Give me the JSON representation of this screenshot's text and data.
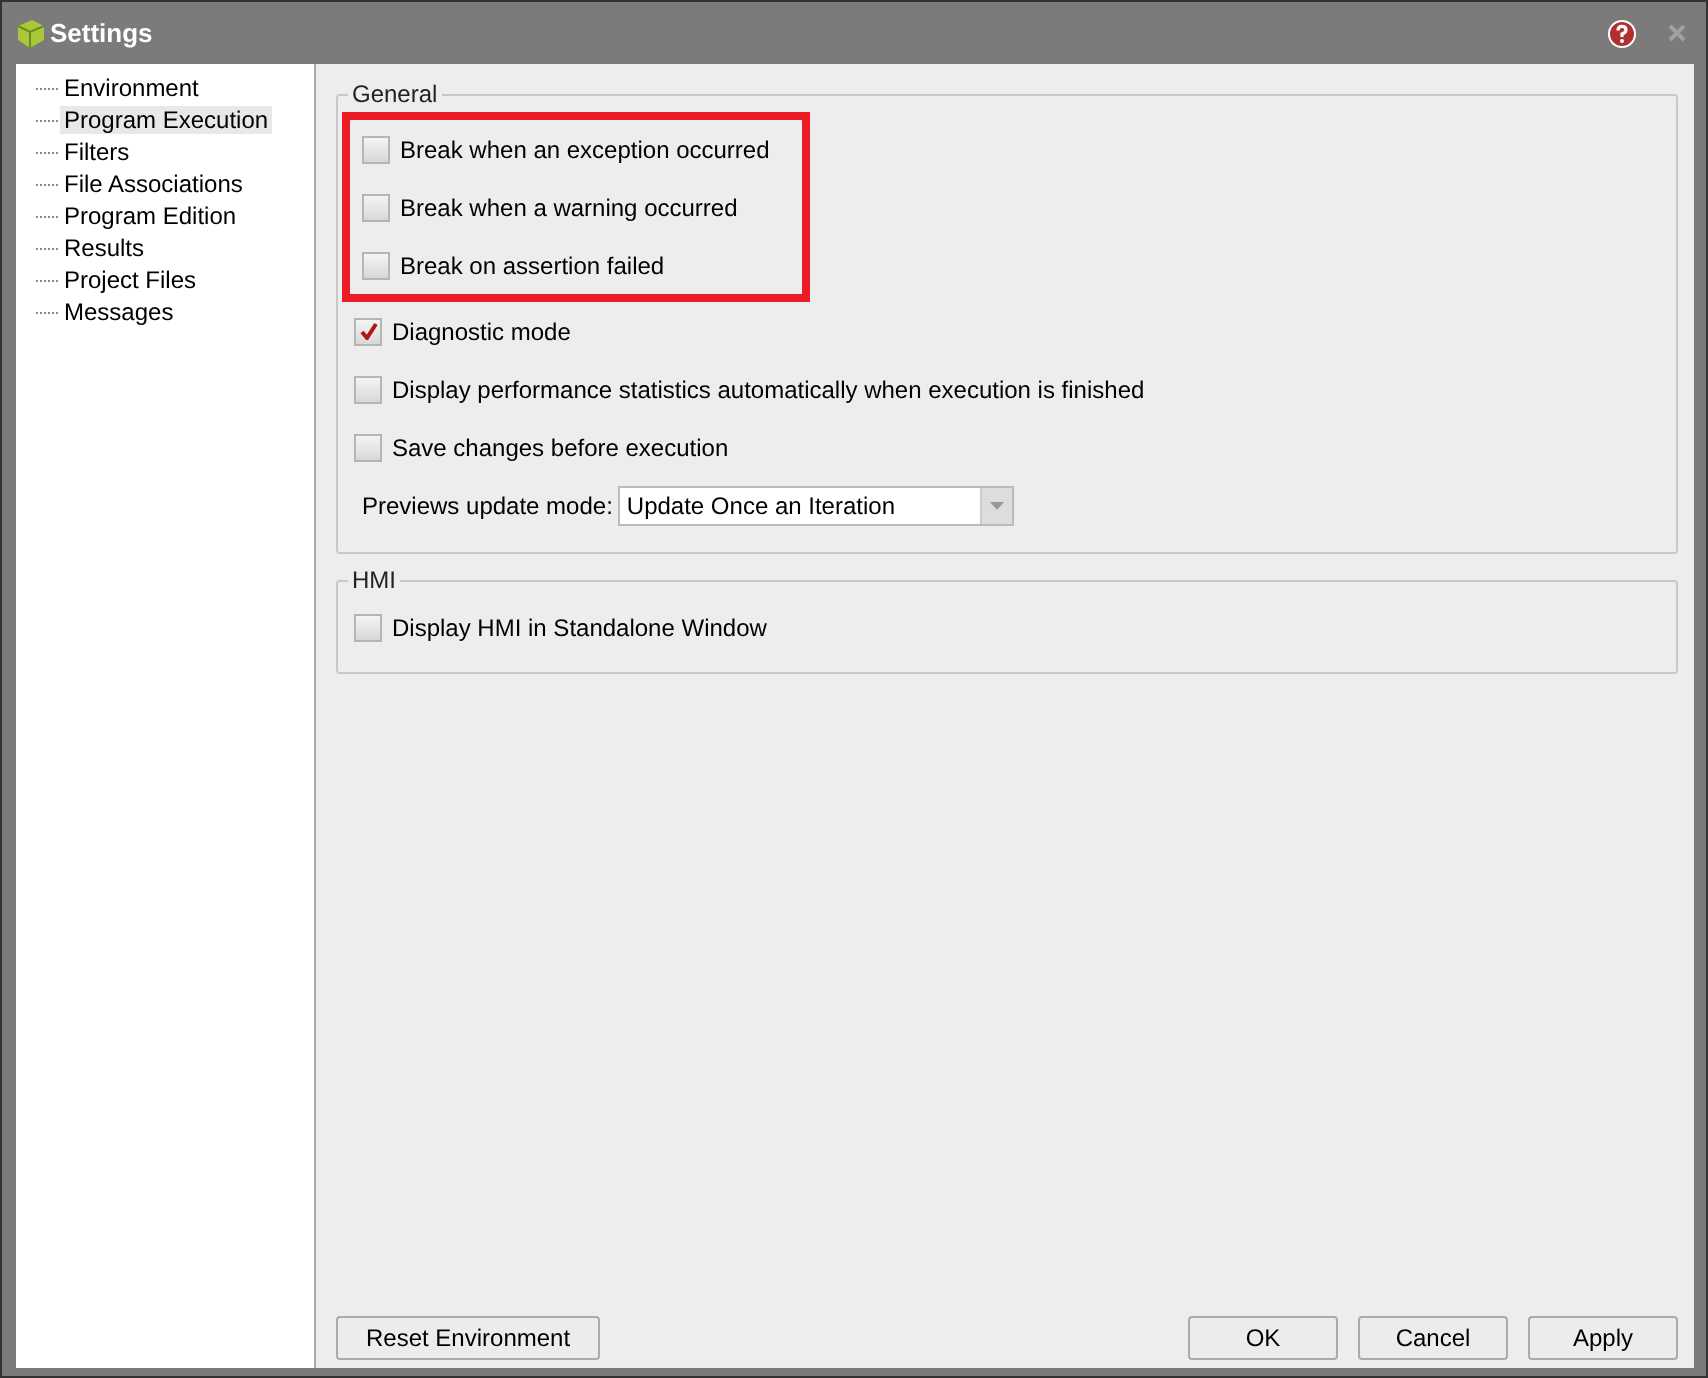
{
  "window": {
    "title": "Settings"
  },
  "sidebar": {
    "items": [
      {
        "label": "Environment",
        "selected": false
      },
      {
        "label": "Program Execution",
        "selected": true
      },
      {
        "label": "Filters",
        "selected": false
      },
      {
        "label": "File Associations",
        "selected": false
      },
      {
        "label": "Program Edition",
        "selected": false
      },
      {
        "label": "Results",
        "selected": false
      },
      {
        "label": "Project Files",
        "selected": false
      },
      {
        "label": "Messages",
        "selected": false
      }
    ]
  },
  "general": {
    "title": "General",
    "options": [
      {
        "label": "Break when an exception occurred",
        "checked": false,
        "highlighted": true
      },
      {
        "label": "Break when a warning occurred",
        "checked": false,
        "highlighted": true
      },
      {
        "label": "Break on assertion failed",
        "checked": false,
        "highlighted": true
      },
      {
        "label": "Diagnostic mode",
        "checked": true,
        "highlighted": false
      },
      {
        "label": "Display performance statistics automatically when execution is finished",
        "checked": false,
        "highlighted": false
      },
      {
        "label": "Save changes before execution",
        "checked": false,
        "highlighted": false
      }
    ],
    "previews_update_mode": {
      "label": "Previews update mode:",
      "value": "Update Once an Iteration"
    }
  },
  "hmi": {
    "title": "HMI",
    "options": [
      {
        "label": "Display HMI in Standalone Window",
        "checked": false,
        "highlighted": false
      }
    ]
  },
  "buttons": {
    "left": [
      "Reset Environment"
    ],
    "right": [
      "OK",
      "Cancel",
      "Apply"
    ]
  }
}
